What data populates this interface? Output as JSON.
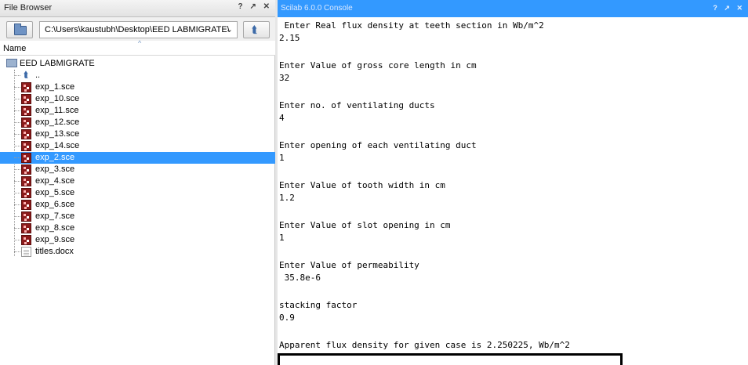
{
  "file_browser": {
    "title": "File Browser",
    "title_buttons": [
      "?",
      "↗",
      "✕"
    ],
    "path": "C:\\Users\\kaustubh\\Desktop\\EED LABMIGRATE\\",
    "column_name": "Name",
    "root_folder": "EED LABMIGRATE",
    "items": [
      {
        "name": "..",
        "type": "up"
      },
      {
        "name": "exp_1.sce",
        "type": "sce"
      },
      {
        "name": "exp_10.sce",
        "type": "sce"
      },
      {
        "name": "exp_11.sce",
        "type": "sce"
      },
      {
        "name": "exp_12.sce",
        "type": "sce"
      },
      {
        "name": "exp_13.sce",
        "type": "sce"
      },
      {
        "name": "exp_14.sce",
        "type": "sce"
      },
      {
        "name": "exp_2.sce",
        "type": "sce",
        "selected": true
      },
      {
        "name": "exp_3.sce",
        "type": "sce"
      },
      {
        "name": "exp_4.sce",
        "type": "sce"
      },
      {
        "name": "exp_5.sce",
        "type": "sce"
      },
      {
        "name": "exp_6.sce",
        "type": "sce"
      },
      {
        "name": "exp_7.sce",
        "type": "sce"
      },
      {
        "name": "exp_8.sce",
        "type": "sce"
      },
      {
        "name": "exp_9.sce",
        "type": "sce"
      },
      {
        "name": "titles.docx",
        "type": "doc"
      }
    ]
  },
  "console": {
    "title": "Scilab 6.0.0 Console",
    "title_buttons": [
      "?",
      "↗",
      "✕"
    ],
    "lines": [
      " Enter Real flux density at teeth section in Wb/m^2",
      "2.15",
      "Enter Value of gross core length in cm",
      "32",
      "Enter no. of ventilating ducts",
      "4",
      "Enter opening of each ventilating duct",
      "1",
      "Enter Value of tooth width in cm",
      "1.2",
      "Enter Value of slot opening in cm",
      "1",
      "Enter Value of permeability",
      " 35.8e-6",
      "stacking factor",
      "0.9",
      "Apparent flux density for given case is 2.250225, Wb/m^2"
    ]
  },
  "colors": {
    "selection": "#3399ff",
    "console_title_bg": "#3399ff",
    "highlight_border": "#000000"
  }
}
